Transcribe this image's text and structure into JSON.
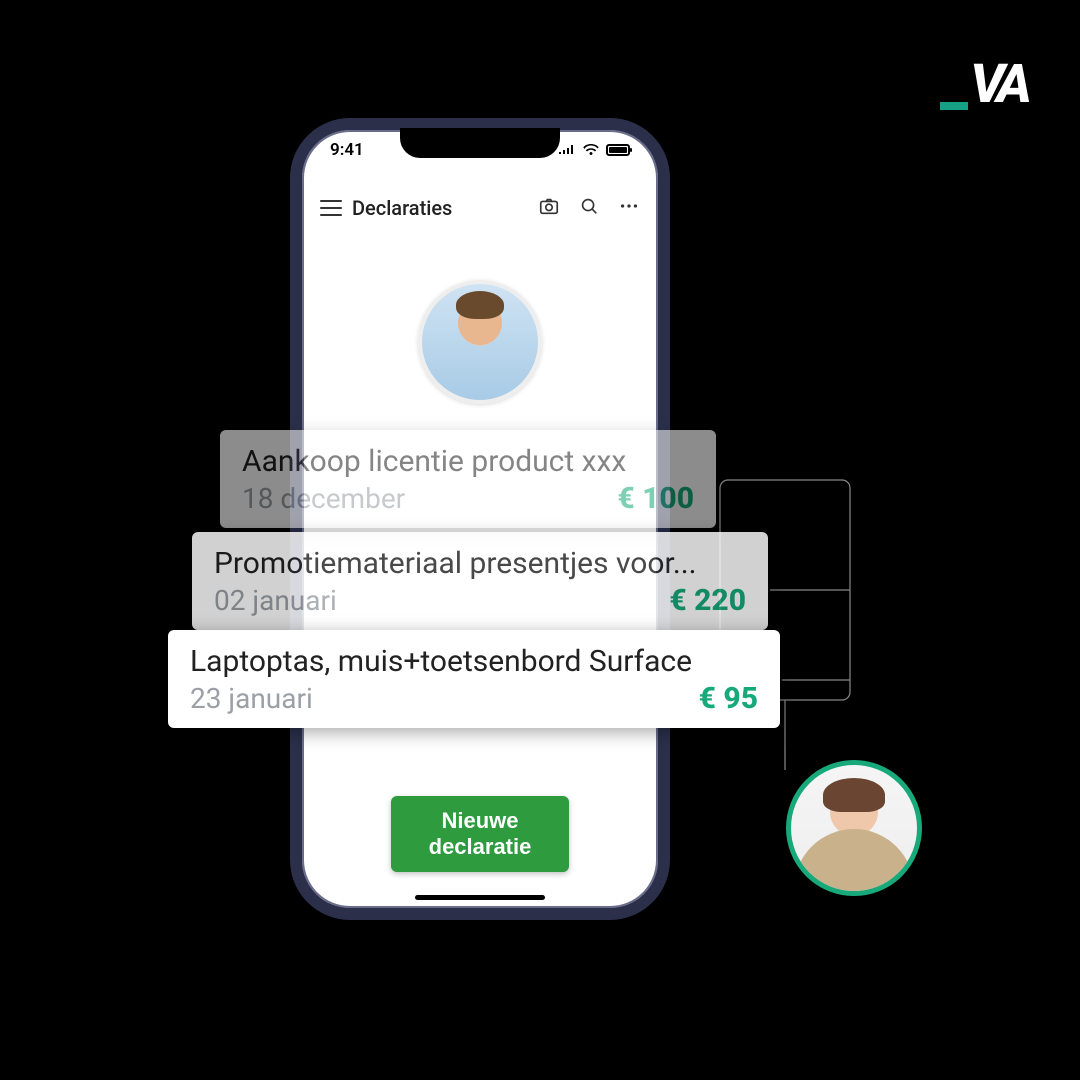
{
  "logo": {
    "text": "VA"
  },
  "status": {
    "time": "9:41"
  },
  "header": {
    "title": "Declaraties",
    "icons": {
      "camera": "camera-icon",
      "search": "search-icon",
      "more": "more-icon",
      "menu": "menu-icon"
    }
  },
  "button": {
    "new_label": "Nieuwe declaratie"
  },
  "colors": {
    "accent": "#18a97a",
    "buttonGreen": "#2e9b3e"
  },
  "cards": [
    {
      "title": "Aankoop licentie product xxx",
      "date": "18 december",
      "amount": "€ 100"
    },
    {
      "title": "Promotiemateriaal presentjes voor...",
      "date": "02 januari",
      "amount": "€ 220"
    },
    {
      "title": "Laptoptas, muis+toetsenbord Surface",
      "date": "23 januari",
      "amount": "€ 95"
    }
  ]
}
